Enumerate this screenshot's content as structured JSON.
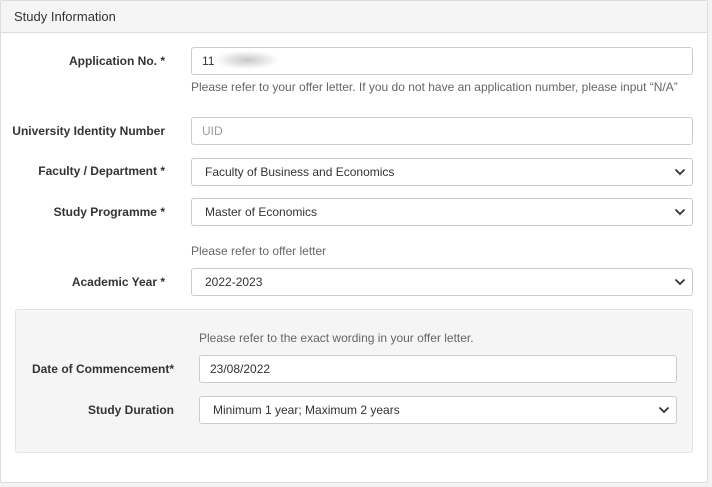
{
  "panel": {
    "title": "Study Information"
  },
  "application_no": {
    "label": "Application No. *",
    "value": "11",
    "help": "Please refer to your offer letter. If you do not have an application number, please input “N/A”"
  },
  "uid": {
    "label": "University Identity Number",
    "placeholder": "UID"
  },
  "faculty": {
    "label": "Faculty / Department *",
    "selected": "Faculty of Business and Economics"
  },
  "programme": {
    "label": "Study Programme *",
    "selected": "Master of Economics",
    "help": "Please refer to offer letter"
  },
  "academic_year": {
    "label": "Academic Year *",
    "selected": "2022-2023"
  },
  "details": {
    "help": "Please refer to the exact wording in your offer letter.",
    "commencement_label": "Date of Commencement*",
    "commencement_value": "23/08/2022",
    "duration_label": "Study Duration",
    "duration_selected": "Minimum 1 year; Maximum 2 years"
  },
  "icons": {
    "select_arrow": "chevron-down-icon"
  }
}
